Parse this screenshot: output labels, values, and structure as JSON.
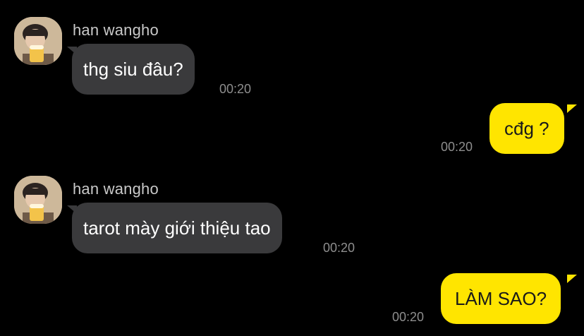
{
  "theme": {
    "background": "#000000",
    "incoming_bubble": "#3a3a3c",
    "outgoing_bubble": "#ffe500",
    "time_color": "#8e8e8e"
  },
  "messages": [
    {
      "direction": "incoming",
      "sender": "han wangho",
      "text": "thg siu đâu?",
      "time": "00:20",
      "avatar_icon": "user-avatar"
    },
    {
      "direction": "outgoing",
      "text": "cđg ?",
      "time": "00:20"
    },
    {
      "direction": "incoming",
      "sender": "han wangho",
      "text": "tarot mày giới thiệu tao",
      "time": "00:20",
      "avatar_icon": "user-avatar"
    },
    {
      "direction": "outgoing",
      "text": "LÀM SAO?",
      "time": "00:20"
    }
  ]
}
